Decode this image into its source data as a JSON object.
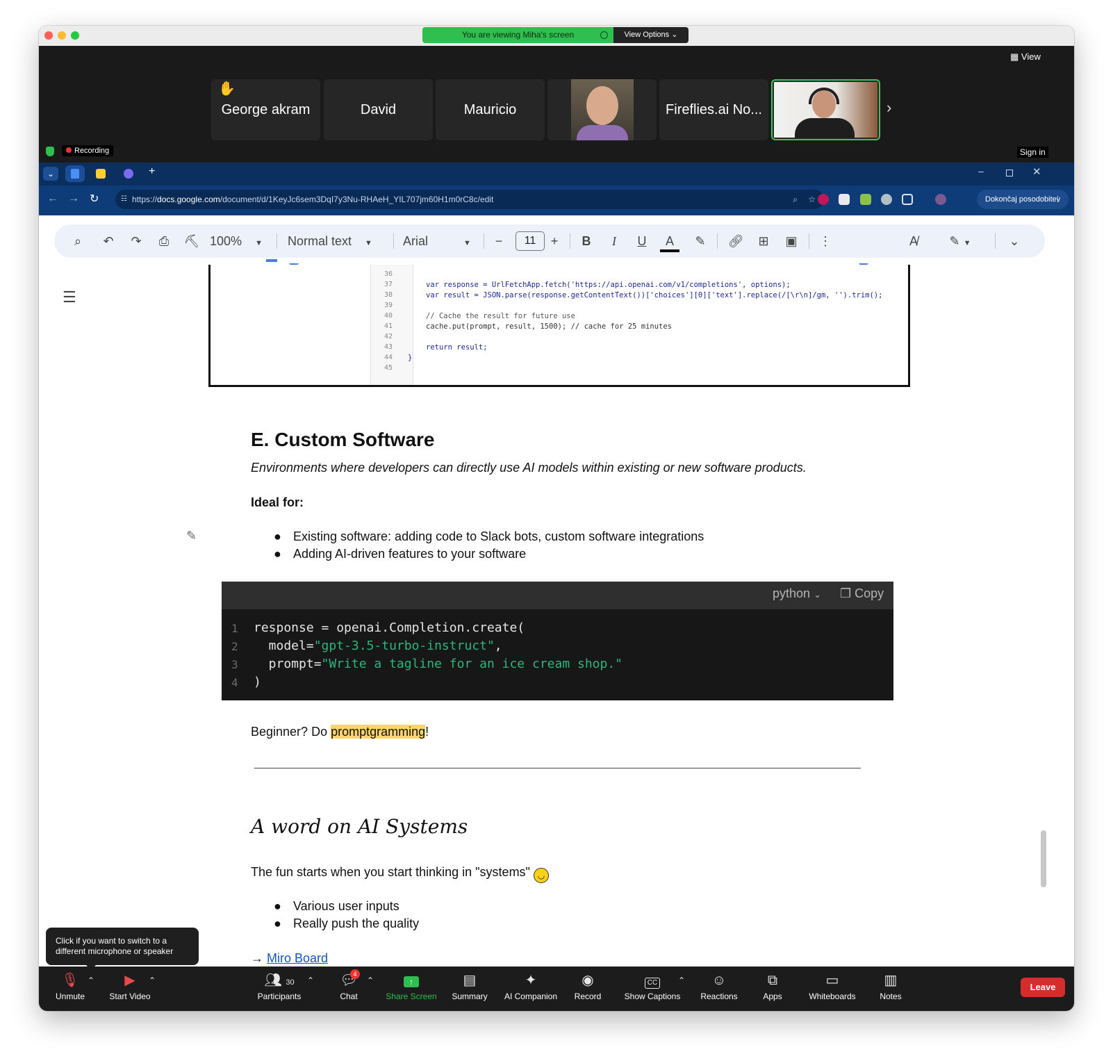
{
  "banner": {
    "viewing": "You are viewing Miha's screen",
    "view_options": "View Options"
  },
  "participants": [
    {
      "name": "George akram",
      "hand": "✋"
    },
    {
      "name": "David"
    },
    {
      "name": "Mauricio"
    },
    {
      "name": ""
    },
    {
      "name": "Fireflies.ai No..."
    },
    {
      "name": ""
    }
  ],
  "zoom_top": {
    "view_label": "View",
    "recording": "Recording",
    "sign_in": "Sign in"
  },
  "browser": {
    "url_prefix": "https://",
    "url_domain": "docs.google.com",
    "url_path": "/document/d/1KeyJc6sem3DqI7y3Nu-RHAeH_YIL707jm60H1m0rC8c/edit",
    "update_label": "Dokončaj posodobitev"
  },
  "docs_toolbar": {
    "zoom": "100%",
    "style": "Normal text",
    "font": "Arial",
    "font_size": "11"
  },
  "code_embed": {
    "lines": [
      {
        "n": "36",
        "code": ""
      },
      {
        "n": "37",
        "code": "var response = UrlFetchApp.fetch('https://api.openai.com/v1/completions', options);"
      },
      {
        "n": "38",
        "code": "var result = JSON.parse(response.getContentText())['choices'][0]['text'].replace(/[\\r\\n]/gm, '').trim();"
      },
      {
        "n": "39",
        "code": ""
      },
      {
        "n": "40",
        "code": "// Cache the result for future use"
      },
      {
        "n": "41",
        "code": "cache.put(prompt, result, 1500); // cache for 25 minutes"
      },
      {
        "n": "42",
        "code": ""
      },
      {
        "n": "43",
        "code": "return result;"
      },
      {
        "n": "44",
        "code": "}"
      },
      {
        "n": "45",
        "code": ""
      }
    ]
  },
  "doc": {
    "section_title": "E. Custom Software",
    "section_subtitle": "Environments where developers can directly use AI models within existing or new software products.",
    "ideal_for": "Ideal for:",
    "bullets": [
      "Existing software: adding code to Slack bots, custom software integrations",
      "Adding AI-driven features to your software"
    ],
    "code_lang": "python",
    "copy_label": "Copy",
    "code_lines": [
      {
        "n": "1",
        "pre": "response = openai.Completion.create(",
        "str": "",
        "post": ""
      },
      {
        "n": "2",
        "pre": "  model=",
        "str": "\"gpt-3.5-turbo-instruct\"",
        "post": ","
      },
      {
        "n": "3",
        "pre": "  prompt=",
        "str": "\"Write a tagline for an ice cream shop.\"",
        "post": ""
      },
      {
        "n": "4",
        "pre": ")",
        "str": "",
        "post": ""
      }
    ],
    "beginner_pre": "Beginner? Do ",
    "beginner_hl": "promptgramming",
    "beginner_post": "!",
    "systems_title": "A word on AI Systems",
    "systems_intro": "The fun starts when you start thinking in \"systems\"",
    "systems_bullets": [
      "Various user inputs",
      "Really push the quality"
    ],
    "arrow": "→",
    "miro_link": "Miro Board"
  },
  "tooltip": "Click if you want to switch to a different microphone or speaker",
  "zoom_bar": {
    "unmute": "Unmute",
    "start_video": "Start Video",
    "participants": "Participants",
    "participants_count": "30",
    "chat": "Chat",
    "chat_badge": "4",
    "share_screen": "Share Screen",
    "summary": "Summary",
    "ai_companion": "AI Companion",
    "record": "Record",
    "show_captions": "Show Captions",
    "reactions": "Reactions",
    "apps": "Apps",
    "whiteboards": "Whiteboards",
    "notes": "Notes",
    "leave": "Leave"
  },
  "colors": {
    "zoom_green": "#2fbf4f",
    "leave_red": "#d72c2c",
    "chrome_blue": "#0e3c79",
    "highlight": "#fbd46a"
  }
}
